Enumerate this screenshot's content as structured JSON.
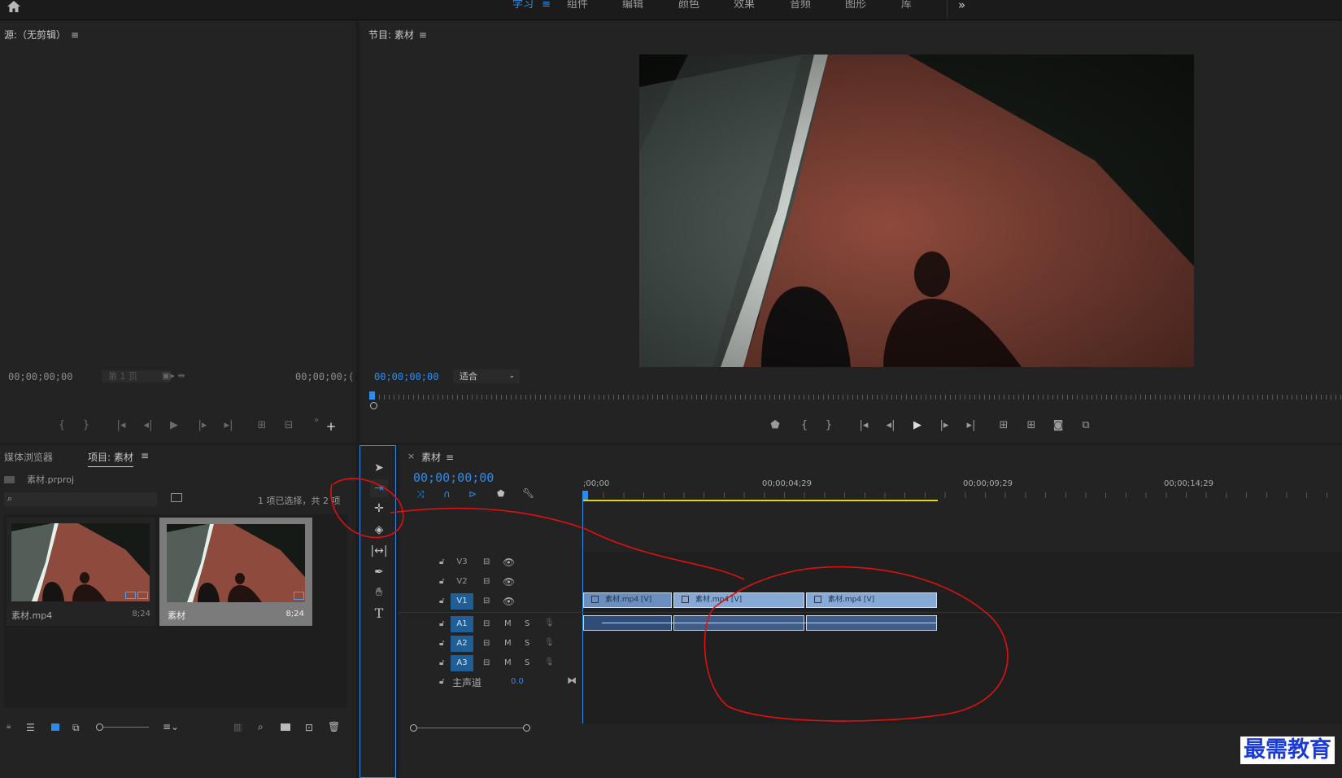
{
  "workspace_tabs": [
    {
      "label": "学习",
      "active": true
    },
    {
      "label": "组件",
      "active": false
    },
    {
      "label": "编辑",
      "active": false
    },
    {
      "label": "颜色",
      "active": false
    },
    {
      "label": "效果",
      "active": false
    },
    {
      "label": "音频",
      "active": false
    },
    {
      "label": "图形",
      "active": false
    },
    {
      "label": "库",
      "active": false
    }
  ],
  "workspace_menu_glyph": "≡",
  "overflow_glyph": "»",
  "source_panel": {
    "title": "源:（无剪辑）",
    "timecode_in": "00;00;00;00",
    "page_label": "第 1 页",
    "timecode_out": "00;00;00;("
  },
  "program_panel": {
    "title": "节目: 素材",
    "timecode": "00;00;00;00",
    "fit_label": "适合"
  },
  "project_panel": {
    "tab_media_browser": "媒体浏览器",
    "tab_project": "项目: 素材",
    "project_file": "素材.prproj",
    "search_placeholder": "",
    "selection_status": "1 项已选择，共 2 项",
    "items": [
      {
        "name": "素材.mp4",
        "duration": "8;24",
        "selected": false
      },
      {
        "name": "素材",
        "duration": "8;24",
        "selected": true
      }
    ]
  },
  "timeline": {
    "sequence_name": "素材",
    "close_glyph": "×",
    "timecode": "00;00;00;00",
    "ruler_labels": [
      ";00;00",
      "00;00;04;29",
      "00;00;09;29",
      "00;00;14;29"
    ],
    "video_tracks": [
      {
        "label": "V3",
        "active": false
      },
      {
        "label": "V2",
        "active": false
      },
      {
        "label": "V1",
        "active": true
      }
    ],
    "audio_tracks": [
      {
        "label": "A1",
        "active": true,
        "m": "M",
        "s": "S"
      },
      {
        "label": "A2",
        "active": true,
        "m": "M",
        "s": "S"
      },
      {
        "label": "A3",
        "active": true,
        "m": "M",
        "s": "S"
      }
    ],
    "master": {
      "label": "主声道",
      "value": "0.0"
    },
    "video_clips": [
      "素材.mp4 [V]",
      "素材.mp4 [V]",
      "素材.mp4 [V]"
    ]
  },
  "watermark": "最需教育",
  "colors": {
    "accent": "#2d8ceb",
    "annotation_red": "#e01010",
    "clip_blue": "#86a9d6",
    "work_area_yellow": "#e6d21a"
  }
}
